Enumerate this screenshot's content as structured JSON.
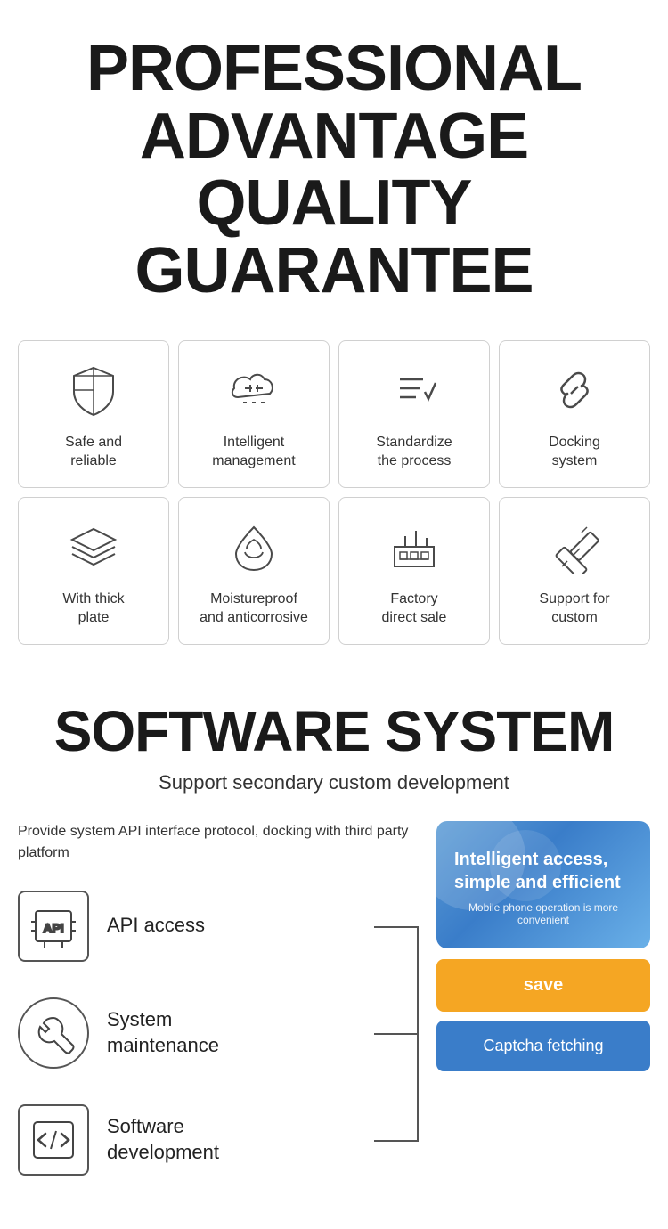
{
  "header": {
    "line1": "PROFESSIONAL",
    "line2": "ADVANTAGE",
    "line3": "QUALITY GUARANTEE"
  },
  "features_row1": [
    {
      "id": "safe-reliable",
      "label": "Safe and\nreliable",
      "icon": "shield"
    },
    {
      "id": "intelligent-management",
      "label": "Intelligent\nmanagement",
      "icon": "cloud-gear"
    },
    {
      "id": "standardize-process",
      "label": "Standardize\nthe process",
      "icon": "list-check"
    },
    {
      "id": "docking-system",
      "label": "Docking\nsystem",
      "icon": "link"
    }
  ],
  "features_row2": [
    {
      "id": "thick-plate",
      "label": "With thick\nplate",
      "icon": "layers"
    },
    {
      "id": "moistureproof",
      "label": "Moistureproof\nand anticorrosive",
      "icon": "droplet-shield"
    },
    {
      "id": "factory-direct",
      "label": "Factory\ndirect sale",
      "icon": "factory"
    },
    {
      "id": "support-custom",
      "label": "Support for\ncustom",
      "icon": "pencil-ruler"
    }
  ],
  "software": {
    "title": "SOFTWARE SYSTEM",
    "subtitle": "Support secondary custom development",
    "description": "Provide system API interface protocol,\ndocking with third party platform",
    "items": [
      {
        "id": "api-access",
        "label": "API access",
        "icon": "api"
      },
      {
        "id": "system-maintenance",
        "label": "System\nmaintenance",
        "icon": "wrench"
      },
      {
        "id": "software-development",
        "label": "Software\ndevelopment",
        "icon": "code"
      }
    ],
    "panel": {
      "title": "Intelligent access,\nsimple and efficient",
      "subtitle": "Mobile phone operation is more convenient",
      "save_btn": "save",
      "captcha_btn": "Captcha fetching"
    }
  }
}
